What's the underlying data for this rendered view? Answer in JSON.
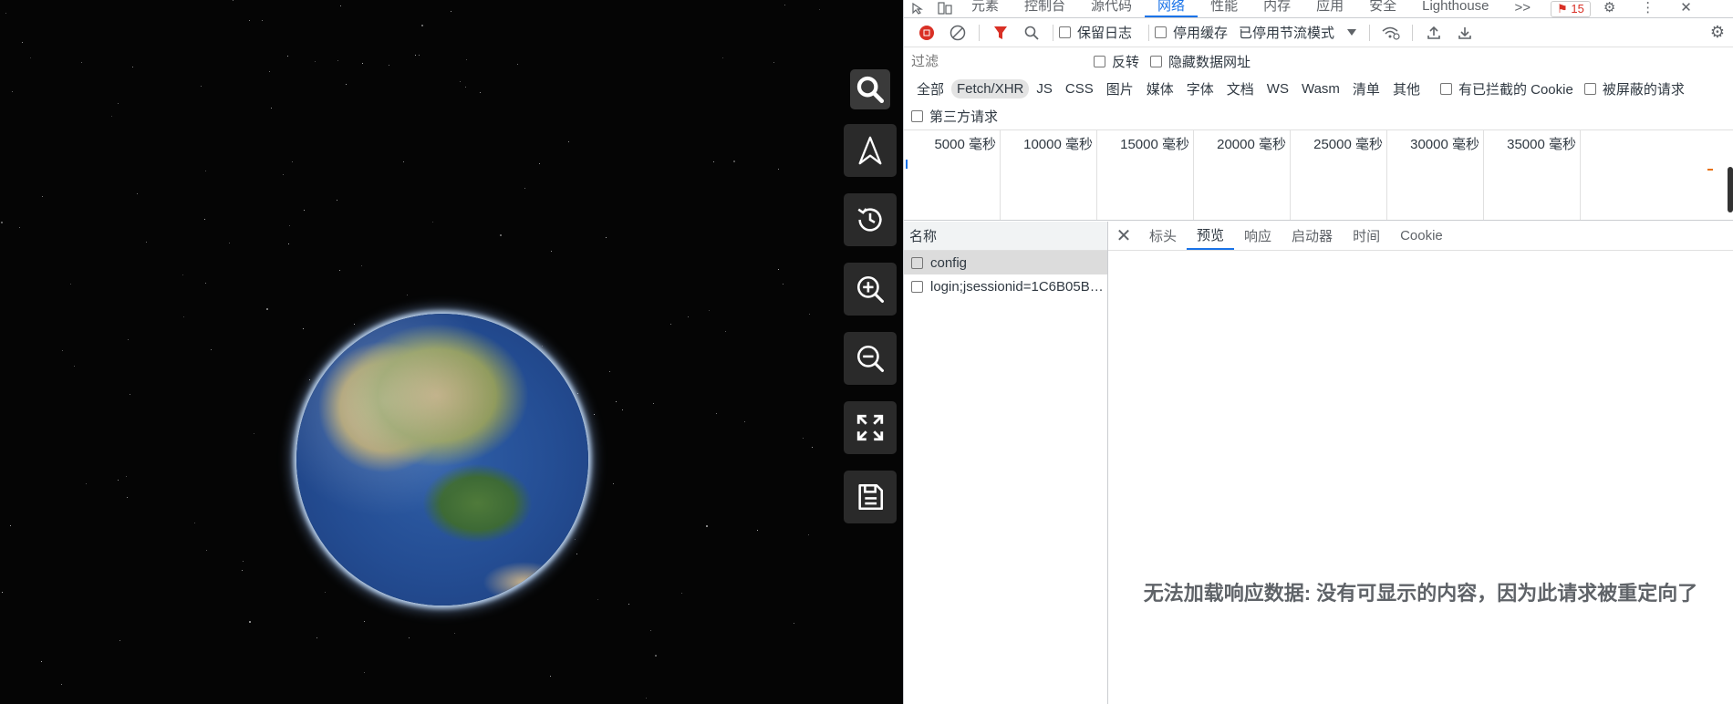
{
  "globe_toolbar": {
    "buttons": [
      {
        "icon": "search-icon"
      },
      {
        "icon": "north-arrow-icon"
      },
      {
        "icon": "history-icon"
      },
      {
        "icon": "zoom-in-icon"
      },
      {
        "icon": "zoom-out-icon"
      },
      {
        "icon": "fullscreen-icon"
      },
      {
        "icon": "save-icon"
      }
    ]
  },
  "devtools": {
    "tabs": [
      "元素",
      "控制台",
      "源代码",
      "网络",
      "性能",
      "内存",
      "应用",
      "安全",
      "Lighthouse"
    ],
    "active_tab": "网络",
    "issues_count": "15",
    "toolbar": {
      "preserve_log": "保留日志",
      "disable_cache": "停用缓存",
      "throttling": "已停用节流模式"
    },
    "filter": {
      "placeholder": "过滤",
      "invert": "反转",
      "hide_data_urls": "隐藏数据网址"
    },
    "types": [
      "全部",
      "Fetch/XHR",
      "JS",
      "CSS",
      "图片",
      "媒体",
      "字体",
      "文档",
      "WS",
      "Wasm",
      "清单",
      "其他"
    ],
    "active_type": "Fetch/XHR",
    "blocked_cookies": "有已拦截的 Cookie",
    "blocked_requests": "被屏蔽的请求",
    "third_party": "第三方请求",
    "timeline_ticks": [
      "5000 毫秒",
      "10000 毫秒",
      "15000 毫秒",
      "20000 毫秒",
      "25000 毫秒",
      "30000 毫秒",
      "35000 毫秒"
    ],
    "name_header": "名称",
    "requests": [
      {
        "name": "config",
        "selected": true
      },
      {
        "name": "login;jsessionid=1C6B05BF...",
        "selected": false
      }
    ],
    "detail_tabs": [
      "标头",
      "预览",
      "响应",
      "启动器",
      "时间",
      "Cookie"
    ],
    "active_detail_tab": "预览",
    "empty_message": "无法加载响应数据: 没有可显示的内容，因为此请求被重定向了"
  }
}
